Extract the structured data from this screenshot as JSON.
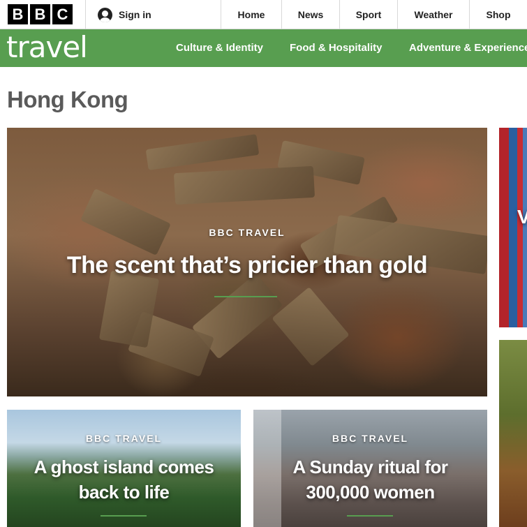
{
  "brand": {
    "logo_letters": [
      "B",
      "B",
      "C"
    ],
    "section_logo": "travel"
  },
  "header": {
    "signin_label": "Sign in",
    "nav": [
      "Home",
      "News",
      "Sport",
      "Weather",
      "Shop"
    ]
  },
  "subnav": [
    "Culture & Identity",
    "Food & Hospitality",
    "Adventure & Experience"
  ],
  "page": {
    "title": "Hong Kong"
  },
  "cards": [
    {
      "label": "BBC TRAVEL",
      "headline": "The scent that’s pricier than gold"
    },
    {
      "label": "BBC TRAVEL",
      "headline": "A ghost island comes back to life"
    },
    {
      "label": "BBC TRAVEL",
      "headline": "A Sunday ritual for 300,000 women"
    },
    {
      "partial_text": "V"
    }
  ],
  "colors": {
    "brand_green": "#589e50",
    "title_gray": "#5a5a5a"
  },
  "icons": {
    "signin": "user-icon"
  }
}
